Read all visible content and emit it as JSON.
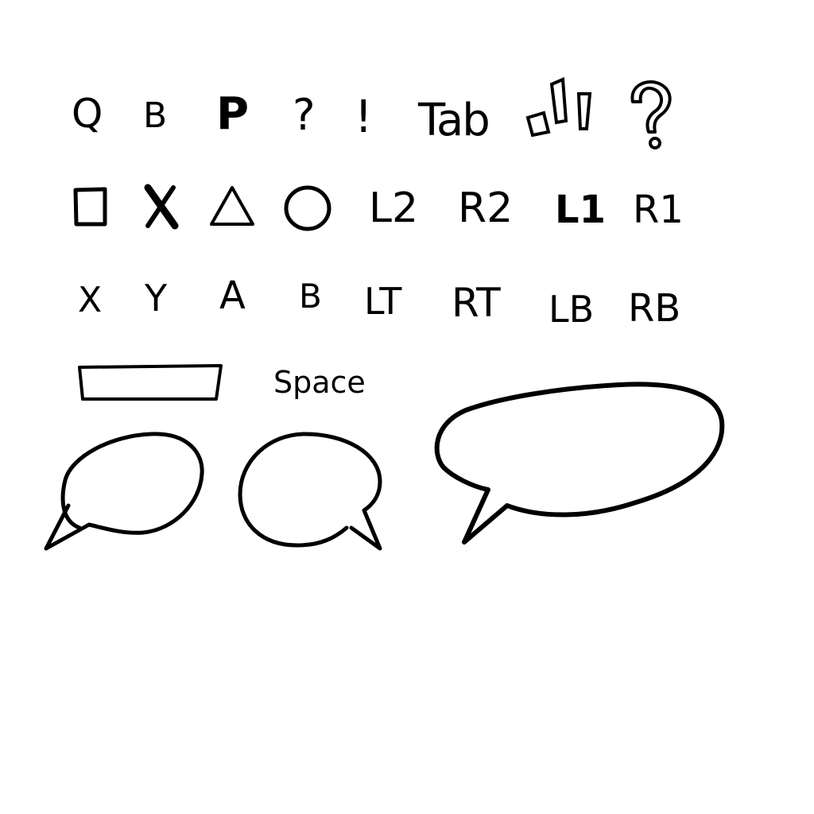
{
  "stroke_color": "#000000",
  "background_color": "#ffffff",
  "row1": {
    "q": "Q",
    "b": "B",
    "p": "P",
    "question": "?",
    "exclaim": "!",
    "tab": "Tab"
  },
  "row2": {
    "l2": "L2",
    "r2": "R2",
    "l1": "L1",
    "r1": "R1"
  },
  "row3": {
    "x": "X",
    "y": "Y",
    "a": "A",
    "b": "B",
    "lt": "LT",
    "rt": "RT",
    "lb": "LB",
    "rb": "RB"
  },
  "space": {
    "label": "Space"
  },
  "icons": {
    "emphasis": "emphasis-lines-icon",
    "big_question": "outlined-question-mark-icon",
    "square": "square-button-icon",
    "cross": "cross-button-icon",
    "triangle": "triangle-button-icon",
    "circle": "circle-button-icon",
    "spacebar": "spacebar-key-icon",
    "bubbles": [
      "speech-bubble-left-tail",
      "speech-bubble-right-tail",
      "speech-bubble-wide"
    ]
  }
}
